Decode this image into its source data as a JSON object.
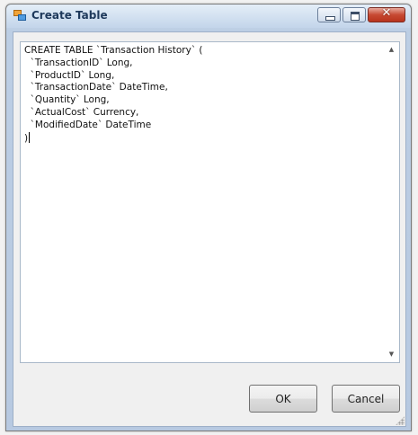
{
  "window": {
    "title": "Create Table",
    "icon": "table-icon",
    "caption_buttons": [
      "minimize-icon",
      "maximize-icon",
      "close-icon"
    ],
    "close_glyph": "✕"
  },
  "editor": {
    "sql_text": "CREATE TABLE `Transaction History` (\n  `TransactionID` Long,\n  `ProductID` Long,\n  `TransactionDate` DateTime,\n  `Quantity` Long,\n  `ActualCost` Currency,\n  `ModifiedDate` DateTime\n)",
    "scroll_up_glyph": "▲",
    "scroll_down_glyph": "▼"
  },
  "buttons": {
    "ok_label": "OK",
    "cancel_label": "Cancel"
  }
}
